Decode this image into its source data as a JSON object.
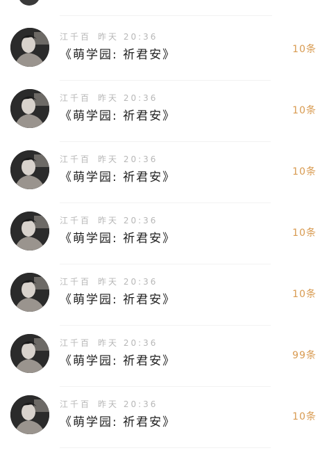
{
  "conversations": [
    {
      "sender": "江千百",
      "time": "昨天 20:36",
      "title": "《萌学园: 祈君安》",
      "count": "10条"
    },
    {
      "sender": "江千百",
      "time": "昨天 20:36",
      "title": "《萌学园: 祈君安》",
      "count": "10条"
    },
    {
      "sender": "江千百",
      "time": "昨天 20:36",
      "title": "《萌学园: 祈君安》",
      "count": "10条"
    },
    {
      "sender": "江千百",
      "time": "昨天 20:36",
      "title": "《萌学园: 祈君安》",
      "count": "10条"
    },
    {
      "sender": "江千百",
      "time": "昨天 20:36",
      "title": "《萌学园: 祈君安》",
      "count": "10条"
    },
    {
      "sender": "江千百",
      "time": "昨天 20:36",
      "title": "《萌学园: 祈君安》",
      "count": "99条"
    },
    {
      "sender": "江千百",
      "time": "昨天 20:36",
      "title": "《萌学园: 祈君安》",
      "count": "10条"
    }
  ],
  "colors": {
    "count_text": "#d89a50",
    "meta_text": "#b7b7b7",
    "title_text": "#1f1f1f"
  }
}
